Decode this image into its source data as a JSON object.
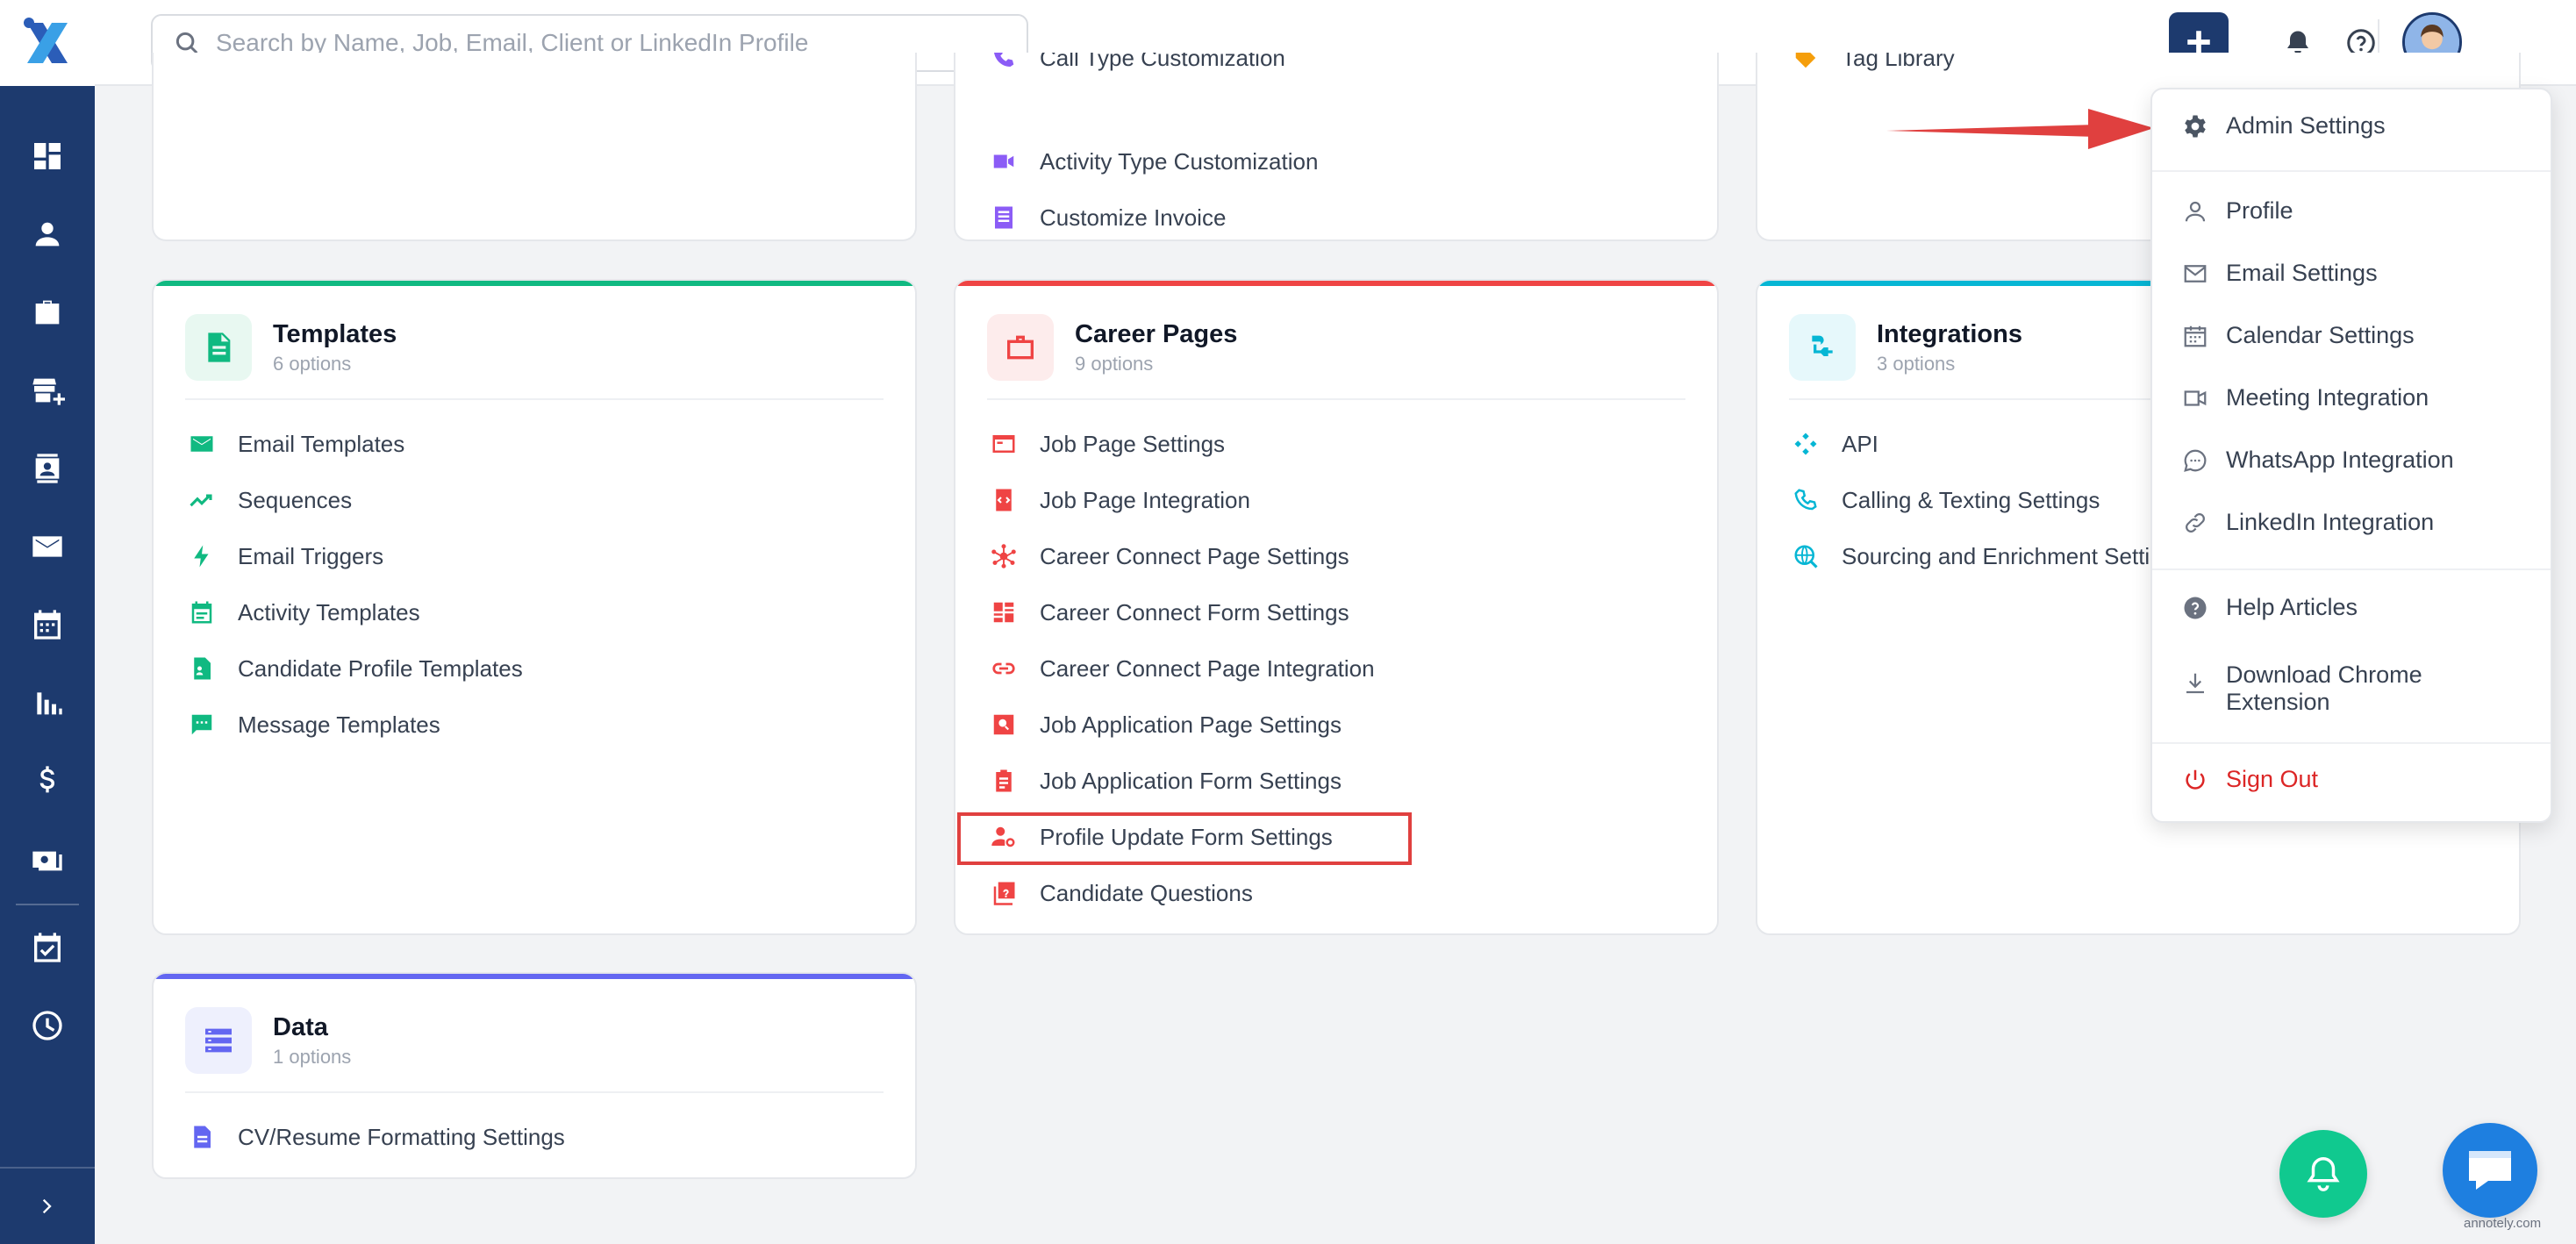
{
  "search": {
    "placeholder": "Search by Name, Job, Email, Client or LinkedIn Profile"
  },
  "partial_top": {
    "middle_items": [
      "Call Type Customization",
      "Activity Type Customization",
      "Customize Invoice"
    ],
    "right_items": [
      "Tag Library"
    ]
  },
  "templates_card": {
    "title": "Templates",
    "subtitle": "6 options",
    "accent": "#10b981",
    "items": [
      "Email Templates",
      "Sequences",
      "Email Triggers",
      "Activity Templates",
      "Candidate Profile Templates",
      "Message Templates"
    ]
  },
  "career_card": {
    "title": "Career Pages",
    "subtitle": "9 options",
    "accent": "#ef4444",
    "items": [
      "Job Page Settings",
      "Job Page Integration",
      "Career Connect Page Settings",
      "Career Connect Form Settings",
      "Career Connect Page Integration",
      "Job Application Page Settings",
      "Job Application Form Settings",
      "Profile Update Form Settings",
      "Candidate Questions"
    ]
  },
  "integrations_card": {
    "title": "Integrations",
    "subtitle": "3 options",
    "accent": "#06b6d4",
    "items": [
      "API",
      "Calling & Texting Settings",
      "Sourcing and Enrichment Settings"
    ]
  },
  "data_card": {
    "title": "Data",
    "subtitle": "1 options",
    "accent": "#6366f1",
    "items": [
      "CV/Resume Formatting Settings"
    ]
  },
  "dropdown": {
    "admin": "Admin Settings",
    "profile": "Profile",
    "email": "Email Settings",
    "calendar": "Calendar Settings",
    "meeting": "Meeting Integration",
    "whatsapp": "WhatsApp Integration",
    "linkedin": "LinkedIn Integration",
    "help": "Help Articles",
    "chrome_line1": "Download Chrome",
    "chrome_line2": "Extension",
    "signout": "Sign Out"
  },
  "watermark": "annotely.com",
  "colors": {
    "sidebar": "#1d3a6e",
    "signout": "#dc2626",
    "highlight": "#e0403f"
  }
}
